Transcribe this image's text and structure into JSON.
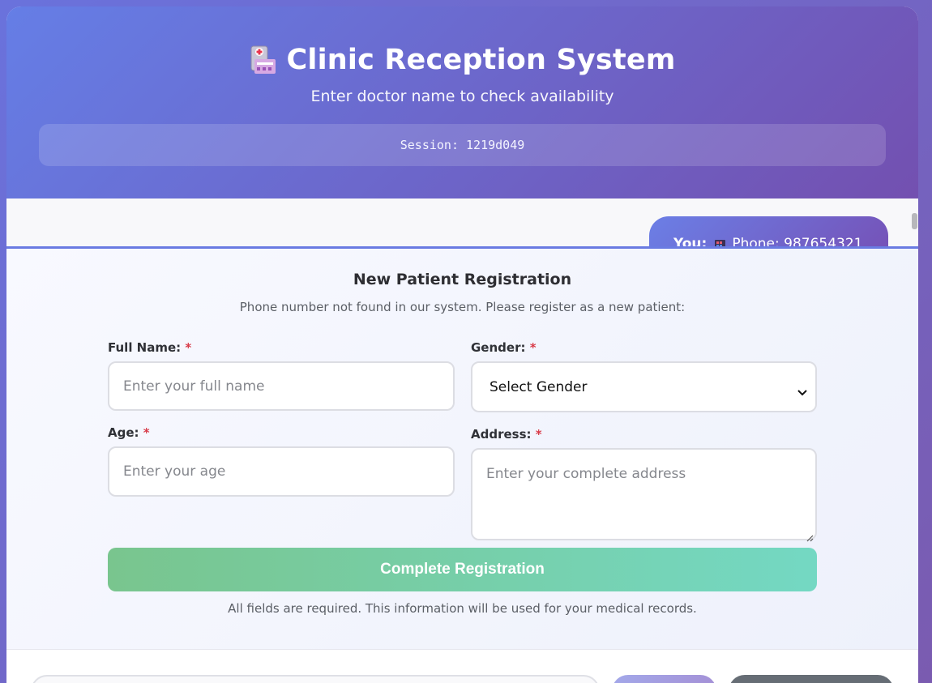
{
  "header": {
    "icon": "hospital-icon",
    "title": "Clinic Reception System",
    "subtitle": "Enter doctor name to check availability",
    "session": "Session: 1219d049"
  },
  "chat": {
    "last_message": {
      "sender": "You:",
      "icon": "phone-icon",
      "text": "Phone: 987654321"
    }
  },
  "registration": {
    "title": "New Patient Registration",
    "description": "Phone number not found in our system. Please register as a new patient:",
    "required_mark": "*",
    "full_name": {
      "label": "Full Name:",
      "placeholder": "Enter your full name",
      "value": ""
    },
    "gender": {
      "label": "Gender:",
      "selected": "Select Gender"
    },
    "age": {
      "label": "Age:",
      "placeholder": "Enter your age",
      "value": ""
    },
    "address": {
      "label": "Address:",
      "placeholder": "Enter your complete address",
      "value": ""
    },
    "submit_label": "Complete Registration",
    "note": "All fields are required. This information will be used for your medical records."
  },
  "colors": {
    "header_start": "#657ee6",
    "header_end": "#7350b0",
    "submit_start": "#79c58e",
    "submit_end": "#74d8c3",
    "required": "#d83a48"
  }
}
